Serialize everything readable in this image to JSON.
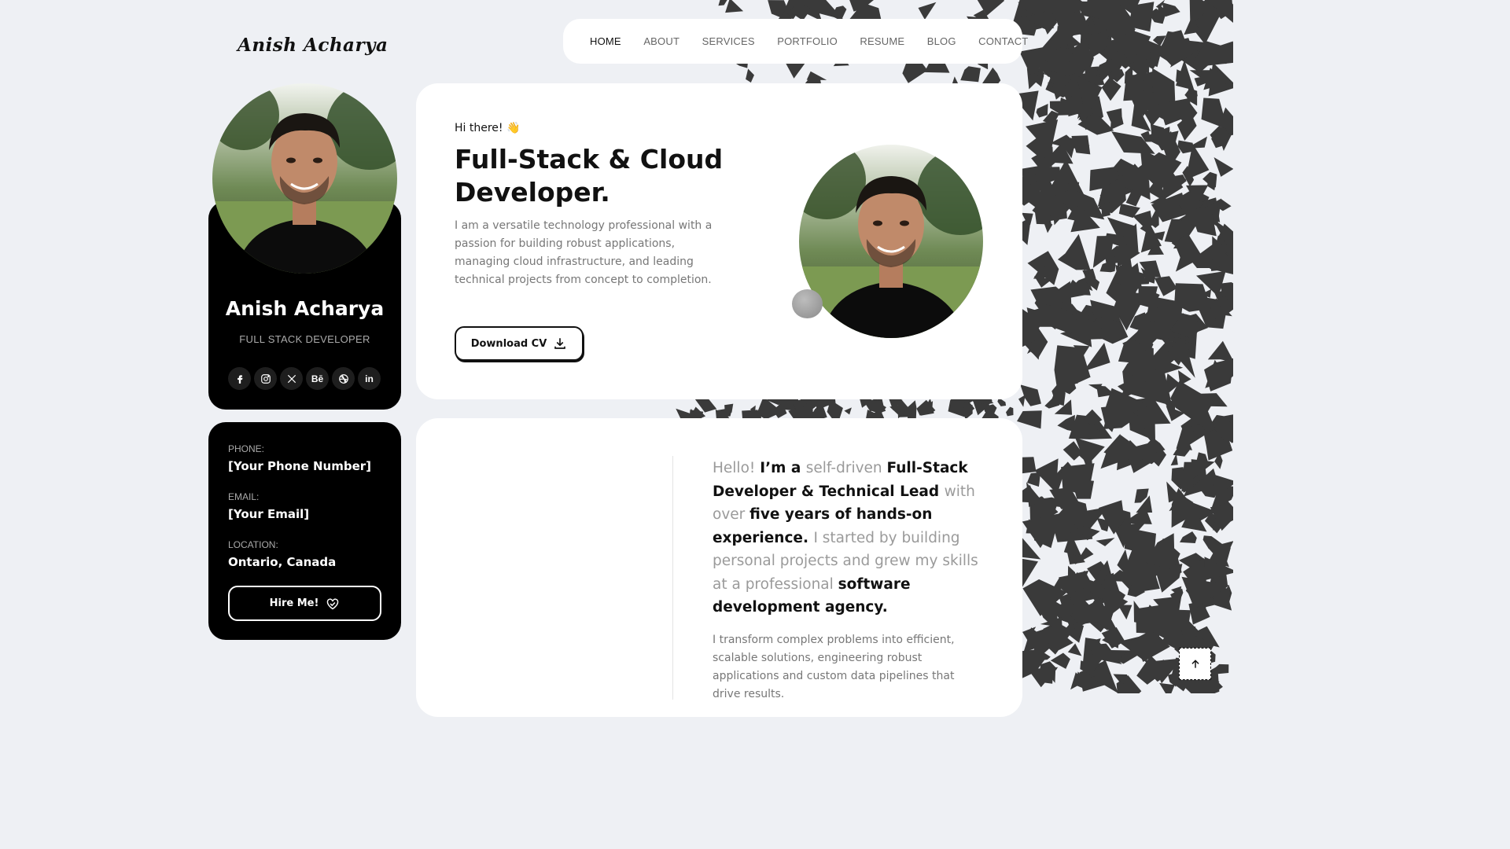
{
  "brand": {
    "logo_text": "Anish Acharya"
  },
  "nav": {
    "items": [
      {
        "label": "HOME",
        "active": true
      },
      {
        "label": "ABOUT"
      },
      {
        "label": "SERVICES"
      },
      {
        "label": "PORTFOLIO"
      },
      {
        "label": "RESUME"
      },
      {
        "label": "BLOG"
      },
      {
        "label": "CONTACT"
      }
    ]
  },
  "profile": {
    "name": "Anish Acharya",
    "role": "FULL STACK DEVELOPER",
    "socials": [
      {
        "icon": "facebook-icon"
      },
      {
        "icon": "instagram-icon"
      },
      {
        "icon": "x-icon"
      },
      {
        "icon": "behance-icon",
        "glyph": "Bē"
      },
      {
        "icon": "dribbble-icon"
      },
      {
        "icon": "linkedin-icon",
        "glyph": "in"
      }
    ]
  },
  "contact": {
    "phone_label": "PHONE:",
    "phone_value": "[Your Phone Number]",
    "email_label": "EMAIL:",
    "email_value": "[Your Email]",
    "location_label": "LOCATION:",
    "location_value": "Ontario, Canada",
    "hire_button": "Hire Me!"
  },
  "hero": {
    "greeting": "Hi there!",
    "greeting_emoji": "👋",
    "title": "Full-Stack & Cloud Developer.",
    "description": "I am a versatile technology professional with a passion for building robust applications, managing cloud infrastructure, and leading technical projects from concept to completion.",
    "download_button": "Download CV"
  },
  "about": {
    "lead_parts": [
      {
        "text": "Hello! ",
        "strong": false
      },
      {
        "text": "I’m a ",
        "strong": true
      },
      {
        "text": "self-driven ",
        "strong": false
      },
      {
        "text": "Full-Stack Developer & Technical Lead ",
        "strong": true
      },
      {
        "text": "with over ",
        "strong": false
      },
      {
        "text": "five years of hands-on experience. ",
        "strong": true
      },
      {
        "text": "I started by building personal projects and grew my skills at a professional ",
        "strong": false
      },
      {
        "text": "software development agency.",
        "strong": true
      }
    ],
    "sub": "I transform complex problems into efficient, scalable solutions, engineering robust applications and custom data pipelines that drive results."
  },
  "colors": {
    "dark_card": "#000000",
    "page_bg": "#eef0f4",
    "pattern": "#3a3a3a"
  }
}
